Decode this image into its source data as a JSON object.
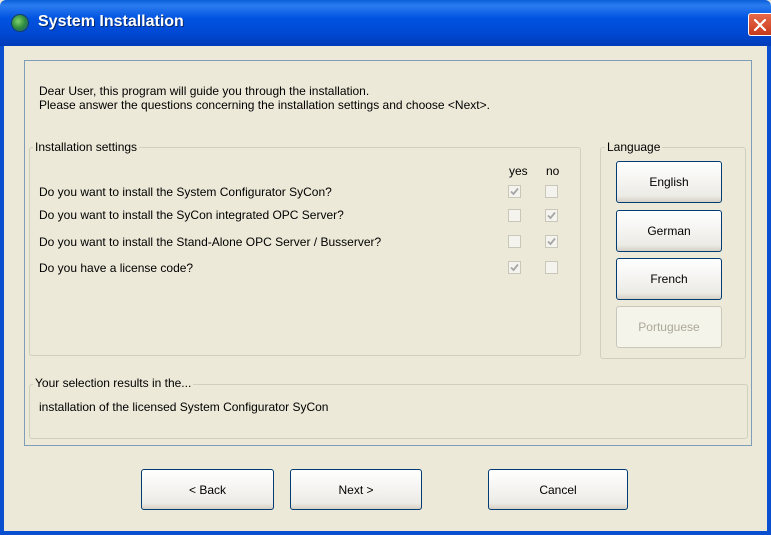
{
  "window": {
    "title": "System Installation",
    "icon": "globe-icon",
    "close_icon": "close-icon"
  },
  "intro": {
    "line1": "Dear User, this program will guide you through the installation.",
    "line2": "Please answer the questions concerning the installation settings and choose <Next>."
  },
  "settings": {
    "title": "Installation settings",
    "yes_label": "yes",
    "no_label": "no",
    "questions": [
      {
        "text": "Do you want to install the System Configurator SyCon?",
        "yes": true,
        "no": false
      },
      {
        "text": "Do you want to install the SyCon integrated OPC Server?",
        "yes": false,
        "no": true
      },
      {
        "text": "Do you want to install the Stand-Alone OPC Server / Busserver?",
        "yes": false,
        "no": true
      },
      {
        "text": "Do you have a license code?",
        "yes": true,
        "no": false
      }
    ]
  },
  "language": {
    "title": "Language",
    "buttons": [
      {
        "label": "English",
        "enabled": true
      },
      {
        "label": "German",
        "enabled": true
      },
      {
        "label": "French",
        "enabled": true
      },
      {
        "label": "Portuguese",
        "enabled": false
      }
    ]
  },
  "result": {
    "title": "Your selection results in the...",
    "text": "installation of the licensed System Configurator SyCon"
  },
  "footer": {
    "back_label": "< Back",
    "next_label": "Next >",
    "cancel_label": "Cancel"
  },
  "colors": {
    "titlebar": "#0053e0",
    "dialog_bg": "#ece9d8",
    "checkbox_check": "#a6a6a6",
    "close_button": "#d5502f"
  }
}
